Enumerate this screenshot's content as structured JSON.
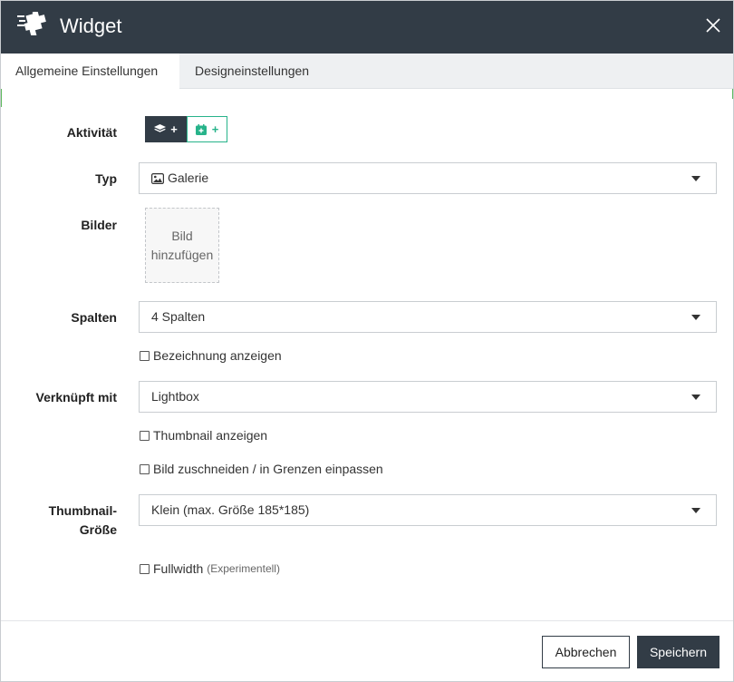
{
  "dialog": {
    "title": "Widget",
    "logo_icon": "puzzle-logo-icon",
    "close_icon": "close-icon"
  },
  "tabs": [
    {
      "label": "Allgemeine Einstellungen",
      "active": true
    },
    {
      "label": "Designeinstellungen",
      "active": false
    }
  ],
  "form": {
    "activity": {
      "label": "Aktivität",
      "buttons": [
        {
          "icon": "layers-icon",
          "text": "+"
        },
        {
          "icon": "calendar-add-icon",
          "text": "+"
        }
      ]
    },
    "type": {
      "label": "Typ",
      "value": "Galerie",
      "icon": "image-icon"
    },
    "images": {
      "label": "Bilder",
      "add_line1": "Bild",
      "add_line2": "hinzufügen"
    },
    "columns": {
      "label": "Spalten",
      "value": "4 Spalten"
    },
    "show_caption": {
      "label": "Bezeichnung anzeigen",
      "checked": false
    },
    "linked_with": {
      "label": "Verknüpft mit",
      "value": "Lightbox"
    },
    "show_thumbnail": {
      "label": "Thumbnail anzeigen",
      "checked": false
    },
    "crop_image": {
      "label": "Bild zuschneiden / in Grenzen einpassen",
      "checked": false
    },
    "thumbnail_size": {
      "label_line1": "Thumbnail-",
      "label_line2": "Größe",
      "value": "Klein (max. Größe 185*185)"
    },
    "fullwidth": {
      "label": "Fullwidth",
      "hint": "(Experimentell)",
      "checked": false
    }
  },
  "footer": {
    "cancel_label": "Abbrechen",
    "save_label": "Speichern"
  },
  "colors": {
    "header_bg": "#323c46",
    "accent_green": "#27b38a",
    "tab_bar_bg": "#eef0f2"
  }
}
